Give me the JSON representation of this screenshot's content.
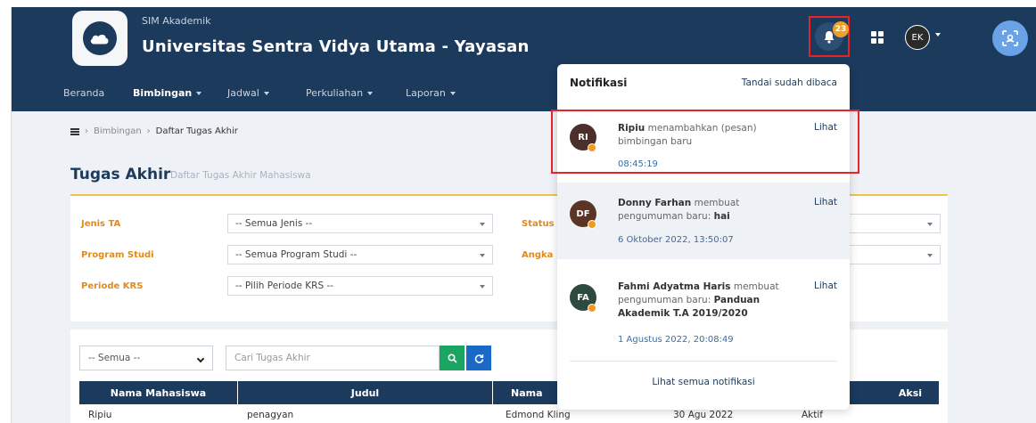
{
  "header": {
    "app_subtitle": "SIM Akademik",
    "app_title": "Universitas Sentra Vidya Utama - Yayasan",
    "notification_count": "23",
    "user_initials": "EK"
  },
  "nav": {
    "items": [
      {
        "label": "Beranda"
      },
      {
        "label": "Bimbingan"
      },
      {
        "label": "Jadwal"
      },
      {
        "label": "Perkuliahan"
      },
      {
        "label": "Laporan"
      }
    ]
  },
  "breadcrumb": {
    "item1": "Bimbingan",
    "item2": "Daftar Tugas Akhir"
  },
  "page": {
    "title": "Tugas Akhir",
    "subtitle": "Daftar Tugas Akhir Mahasiswa"
  },
  "filters": {
    "jenis_label": "Jenis TA",
    "jenis_value": "-- Semua Jenis --",
    "status_label": "Status",
    "prodi_label": "Program Studi",
    "prodi_value": "-- Semua Program Studi --",
    "angkatan_label": "Angka",
    "periode_label": "Periode KRS",
    "periode_value": "-- Pilih Periode KRS --"
  },
  "table": {
    "filter_value": "-- Semua --",
    "search_placeholder": "Cari Tugas Akhir",
    "columns": [
      "Nama Mahasiswa",
      "Judul",
      "Nama",
      "Aksi"
    ],
    "rows": [
      {
        "nama": "Ripiu",
        "judul": "penagyan",
        "pembimbing": "Edmond Kling",
        "tanggal": "30 Agu 2022",
        "status": "Aktif"
      }
    ]
  },
  "notifications": {
    "title": "Notifikasi",
    "mark_read": "Tandai sudah dibaca",
    "view_all": "Lihat semua notifikasi",
    "items": [
      {
        "initials": "RI",
        "name": "Ripiu",
        "text": "menambahkan (pesan) bimbingan baru",
        "bold": "",
        "time": "08:45:19",
        "action": "Lihat",
        "avatar_color": "#4a2f2a"
      },
      {
        "initials": "DF",
        "name": "Donny Farhan",
        "text": "membuat pengumuman baru:",
        "bold": "hai",
        "time": "6 Oktober 2022, 13:50:07",
        "action": "Lihat",
        "avatar_color": "#5a3524"
      },
      {
        "initials": "FA",
        "name": "Fahmi Adyatma Haris",
        "text": "membuat pengumuman baru:",
        "bold": "Panduan Akademik T.A 2019/2020",
        "time": "1 Agustus 2022, 20:08:49",
        "action": "Lihat",
        "avatar_color": "#2e4a3e"
      }
    ]
  },
  "colors": {
    "primary": "#1b3a5c",
    "accent": "#f0a12a",
    "highlight": "#e8222a"
  }
}
